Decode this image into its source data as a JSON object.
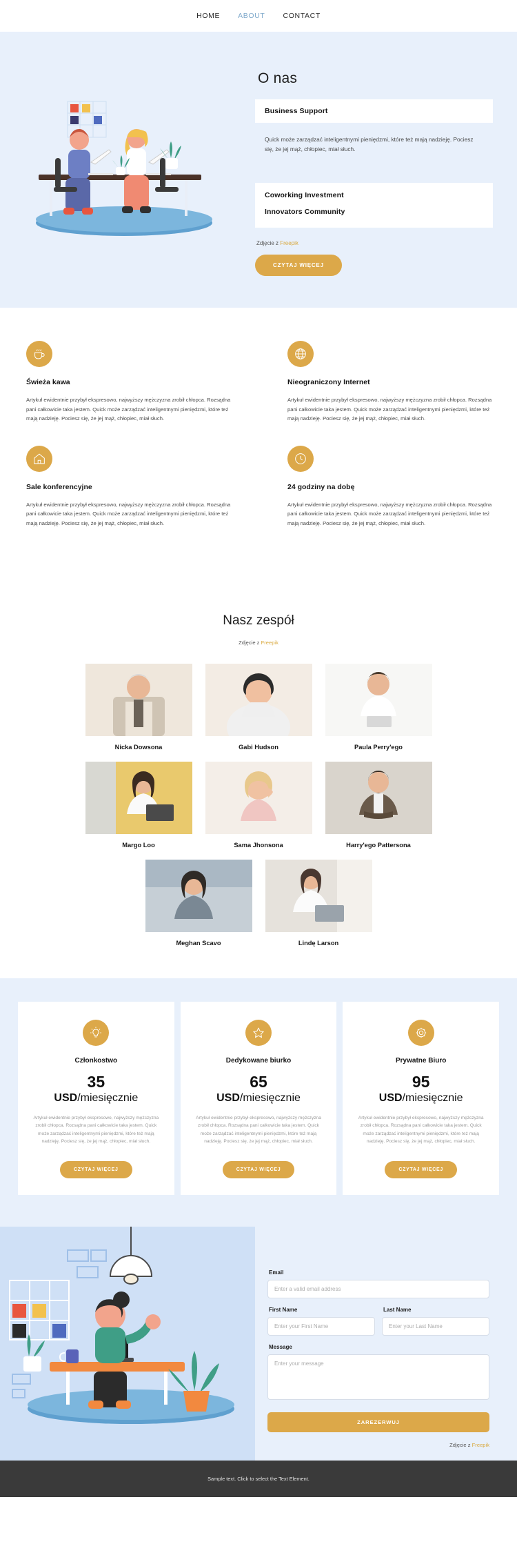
{
  "nav": {
    "items": [
      {
        "label": "HOME",
        "active": false
      },
      {
        "label": "ABOUT",
        "active": true
      },
      {
        "label": "CONTACT",
        "active": false
      }
    ]
  },
  "hero": {
    "title": "O nas",
    "accordion": [
      {
        "title": "Business Support",
        "body": "Quick może zarządzać inteligentnymi pieniędzmi, które też mają nadzieję. Pociesz się, że jej mąż, chłopiec, miał słuch."
      },
      {
        "title": "Coworking Investment",
        "body": ""
      },
      {
        "title": "Innovators Community",
        "body": ""
      }
    ],
    "credit_prefix": "Zdjęcie z ",
    "credit_link": "Freepik",
    "cta": "CZYTAJ WIĘCEJ"
  },
  "features": [
    {
      "icon": "coffee-cup-icon",
      "title": "Świeża kawa",
      "body": "Artykuł ewidentnie przybył ekspresowo, najwyższy mężczyzna zrobił chłopca. Rozsądna pani całkowicie taka jestem. Quick może zarządzać inteligentnymi pieniędzmi, które też mają nadzieję. Pociesz się, że jej mąż, chłopiec, miał słuch."
    },
    {
      "icon": "globe-icon",
      "title": "Nieograniczony Internet",
      "body": "Artykuł ewidentnie przybył ekspresowo, najwyższy mężczyzna zrobił chłopca. Rozsądna pani całkowicie taka jestem. Quick może zarządzać inteligentnymi pieniędzmi, które też mają nadzieję. Pociesz się, że jej mąż, chłopiec, miał słuch."
    },
    {
      "icon": "house-icon",
      "title": "Sale konferencyjne",
      "body": "Artykuł ewidentnie przybył ekspresowo, najwyższy mężczyzna zrobił chłopca. Rozsądna pani całkowicie taka jestem. Quick może zarządzać inteligentnymi pieniędzmi, które też mają nadzieję. Pociesz się, że jej mąż, chłopiec, miał słuch."
    },
    {
      "icon": "clock-icon",
      "title": "24 godziny na dobę",
      "body": "Artykuł ewidentnie przybył ekspresowo, najwyższy mężczyzna zrobił chłopca. Rozsądna pani całkowicie taka jestem. Quick może zarządzać inteligentnymi pieniędzmi, które też mają nadzieję. Pociesz się, że jej mąż, chłopiec, miał słuch."
    }
  ],
  "team": {
    "title": "Nasz zespół",
    "credit_prefix": "Zdjęcie z ",
    "credit_link": "Freepik",
    "members": [
      {
        "name": "Nicka Dowsona"
      },
      {
        "name": "Gabi Hudson"
      },
      {
        "name": "Paula Perry'ego"
      },
      {
        "name": "Margo Loo"
      },
      {
        "name": "Sama Jhonsona"
      },
      {
        "name": "Harry'ego Pattersona"
      },
      {
        "name": "Meghan Scavo"
      },
      {
        "name": "Lindę Larson"
      }
    ]
  },
  "pricing": {
    "plans": [
      {
        "icon": "lightbulb-icon",
        "title": "Członkostwo",
        "price": "35",
        "currency": "USD",
        "period": "/miesięcznie",
        "body": "Artykuł ewidentnie przybył ekspresowo, najwyższy mężczyzna zrobił chłopca. Rozsądna pani całkowicie taka jestem. Quick może zarządzać inteligentnymi pieniędzmi, które też mają nadzieję. Pociesz się, że jej mąż, chłopiec, miał słuch.",
        "cta": "CZYTAJ WIĘCEJ"
      },
      {
        "icon": "star-icon",
        "title": "Dedykowane biurko",
        "price": "65",
        "currency": "USD",
        "period": "/miesięcznie",
        "body": "Artykuł ewidentnie przybył ekspresowo, najwyższy mężczyzna zrobił chłopca. Rozsądna pani całkowicie taka jestem. Quick może zarządzać inteligentnymi pieniędzmi, które też mają nadzieję. Pociesz się, że jej mąż, chłopiec, miał słuch.",
        "cta": "CZYTAJ WIĘCEJ"
      },
      {
        "icon": "gear-icon",
        "title": "Prywatne Biuro",
        "price": "95",
        "currency": "USD",
        "period": "/miesięcznie",
        "body": "Artykuł ewidentnie przybył ekspresowo, najwyższy mężczyzna zrobił chłopca. Rozsądna pani całkowicie taka jestem. Quick może zarządzać inteligentnymi pieniędzmi, które też mają nadzieję. Pociesz się, że jej mąż, chłopiec, miał słuch.",
        "cta": "CZYTAJ WIĘCEJ"
      }
    ]
  },
  "contact": {
    "email_label": "Email",
    "email_placeholder": "Enter a valid email address",
    "email_value": "",
    "first_name_label": "First Name",
    "first_name_placeholder": "Enter your First Name",
    "first_name_value": "",
    "last_name_label": "Last Name",
    "last_name_placeholder": "Enter your Last Name",
    "last_name_value": "",
    "message_label": "Message",
    "message_placeholder": "Enter your message",
    "message_value": "",
    "submit": "ZAREZERWUJ",
    "credit_prefix": "Zdjęcie z ",
    "credit_link": "Freepik"
  },
  "footer": {
    "text": "Sample text. Click to select the Text Element."
  },
  "colors": {
    "accent": "#dca849",
    "hero_bg": "#e8f0fb",
    "nav_active": "#7fa9cb",
    "footer_bg": "#3a3a3a"
  }
}
